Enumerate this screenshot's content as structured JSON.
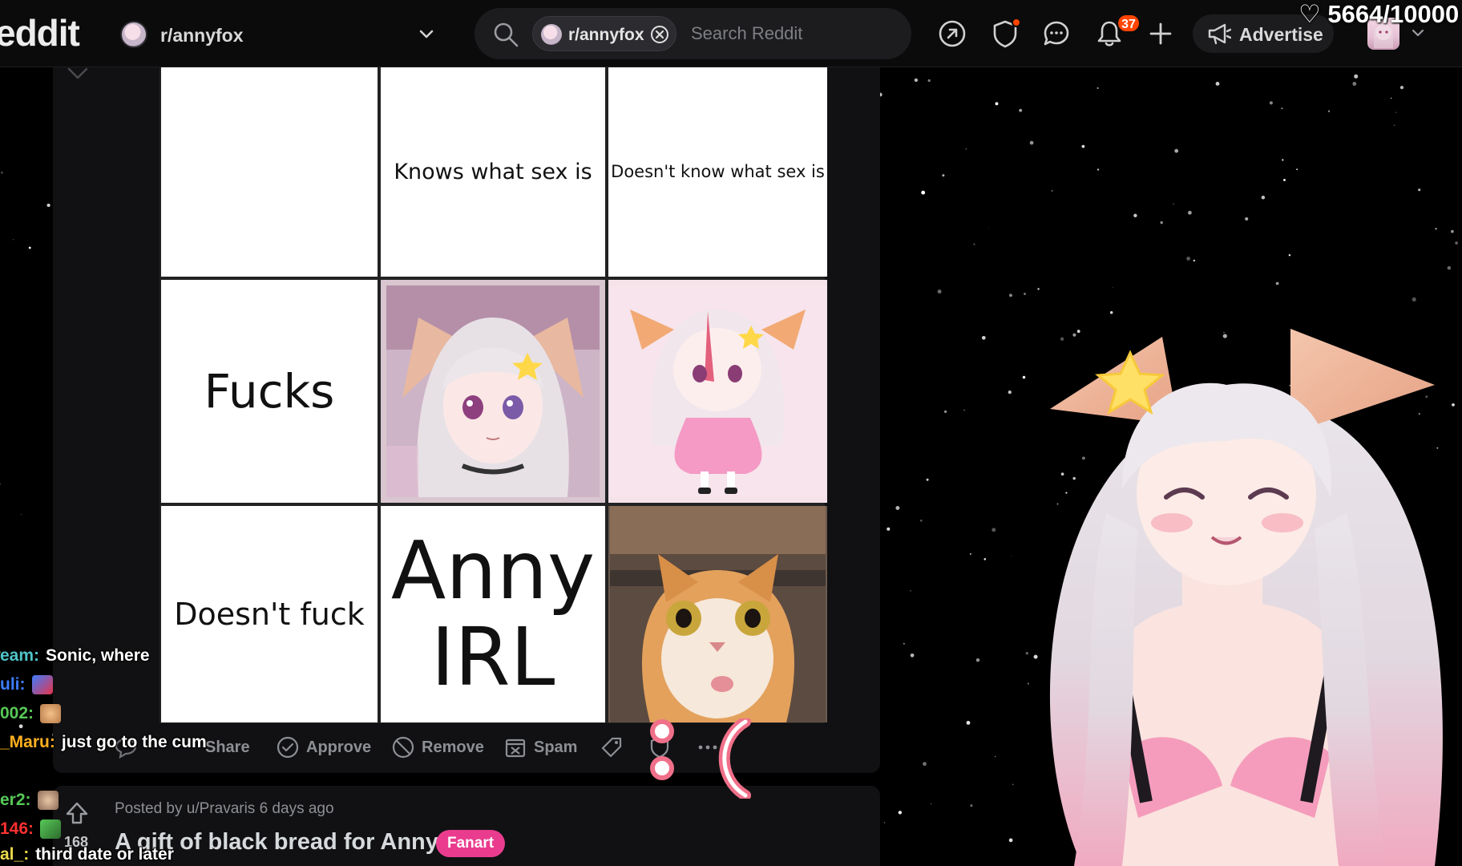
{
  "overlay": {
    "goal_counter": "♡ 5664/10000"
  },
  "topbar": {
    "logo": "eddit",
    "subreddit": "r/annyfox",
    "search": {
      "chip_label": "r/annyfox",
      "placeholder": "Search Reddit"
    },
    "notification_count": "37",
    "advertise_label": "Advertise",
    "accent": "#ff4500"
  },
  "meme": {
    "col_headers": [
      "Knows what sex is",
      "Doesn't know what sex is"
    ],
    "row_headers": [
      "Fucks",
      "Doesn't fuck"
    ],
    "anny_irl": [
      "Anny",
      "IRL"
    ]
  },
  "actions": {
    "share": "Share",
    "approve": "Approve",
    "remove": "Remove",
    "spam": "Spam"
  },
  "post2": {
    "score": "168",
    "meta": "Posted by u/Pravaris 6 days ago",
    "title": "A gift of black bread for Anny",
    "flair": "Fanart",
    "flair_color": "#ea3c8e"
  },
  "chat": [
    {
      "user": "eam:",
      "message": "Sonic, where",
      "color": "#4fc3c8"
    },
    {
      "user": "uli:",
      "message": "",
      "color": "#3d7cff"
    },
    {
      "user": "002:",
      "message": "",
      "color": "#57c957"
    },
    {
      "user": "_Maru:",
      "message": "just go to the cum",
      "color": "#ffb020"
    },
    {
      "user": "er2:",
      "message": "",
      "color": "#57c957"
    },
    {
      "user": "146:",
      "message": "",
      "color": "#ff3030"
    },
    {
      "user": "al_:",
      "message": "third date or later",
      "color": "#e9d84a"
    }
  ],
  "emoticon": ":("
}
